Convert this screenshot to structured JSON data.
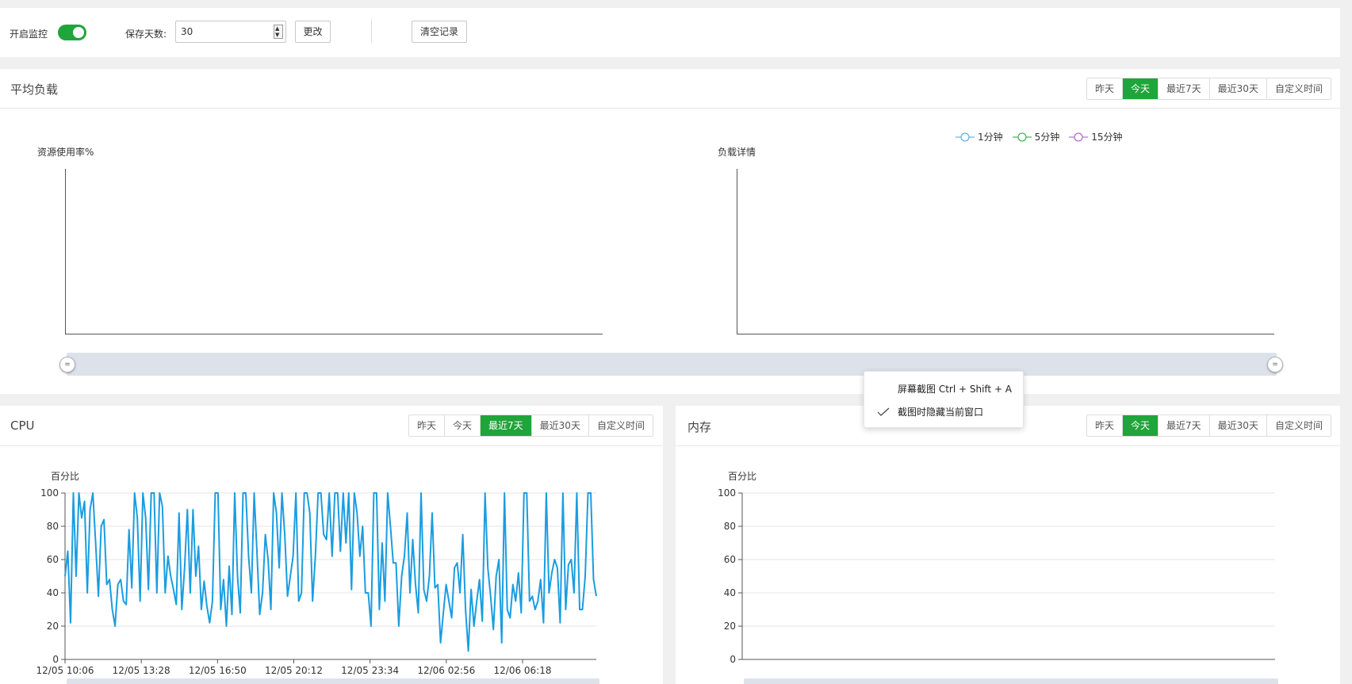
{
  "top": {
    "monitor_label": "开启监控",
    "monitor_on": true,
    "days_label": "保存天数:",
    "days_value": "30",
    "change_button": "更改",
    "clear_button": "清空记录"
  },
  "load": {
    "title": "平均负载",
    "range_buttons": [
      "昨天",
      "今天",
      "最近7天",
      "最近30天",
      "自定义时间"
    ],
    "active_range": "今天",
    "left_chart_label": "资源使用率%",
    "right_chart_label": "负载详情",
    "legend": [
      {
        "name": "1分钟",
        "color": "#4aa3df"
      },
      {
        "name": "5分钟",
        "color": "#20a53a"
      },
      {
        "name": "15分钟",
        "color": "#a44fd6"
      }
    ],
    "slider_handle_glyph": "="
  },
  "cpu": {
    "title": "CPU",
    "range_buttons": [
      "昨天",
      "今天",
      "最近7天",
      "最近30天",
      "自定义时间"
    ],
    "active_range": "最近7天",
    "color": "#1a9de0"
  },
  "memory": {
    "title": "内存",
    "range_buttons": [
      "昨天",
      "今天",
      "最近7天",
      "最近30天",
      "自定义时间"
    ],
    "active_range": "今天"
  },
  "context_menu": {
    "items": [
      {
        "label": "屏幕截图 Ctrl + Shift + A",
        "checked": false
      },
      {
        "label": "截图时隐藏当前窗口",
        "checked": true
      }
    ]
  },
  "chart_data": [
    {
      "type": "line",
      "ylabel": "资源使用率%",
      "series": []
    },
    {
      "type": "line",
      "ylabel": "负载详情",
      "series": [
        {
          "name": "1分钟",
          "values": []
        },
        {
          "name": "5分钟",
          "values": []
        },
        {
          "name": "15分钟",
          "values": []
        }
      ]
    },
    {
      "type": "line",
      "ylabel": "百分比",
      "ylim": [
        0,
        100
      ],
      "yticks": [
        "0",
        "20",
        "40",
        "60",
        "80",
        "100"
      ],
      "xticks": [
        "12/05 10:06",
        "12/05 13:28",
        "12/05 16:50",
        "12/05 20:12",
        "12/05 23:34",
        "12/06 02:56",
        "12/06 06:18"
      ],
      "grid": true,
      "series": [
        {
          "values": [
            50,
            65,
            22,
            100,
            50,
            100,
            85,
            95,
            40,
            90,
            100,
            70,
            38,
            80,
            84,
            45,
            48,
            30,
            20,
            45,
            48,
            35,
            33,
            78,
            43,
            100,
            85,
            35,
            100,
            85,
            42,
            100,
            100,
            40,
            100,
            92,
            40,
            62,
            50,
            42,
            33,
            88,
            30,
            55,
            90,
            40,
            90,
            50,
            68,
            30,
            47,
            32,
            22,
            35,
            100,
            100,
            30,
            48,
            20,
            56,
            27,
            100,
            50,
            28,
            100,
            100,
            62,
            40,
            100,
            65,
            27,
            40,
            75,
            60,
            30,
            100,
            88,
            55,
            100,
            75,
            38,
            50,
            62,
            100,
            35,
            40,
            100,
            100,
            88,
            35,
            62,
            100,
            100,
            75,
            72,
            100,
            62,
            100,
            100,
            65,
            100,
            70,
            100,
            42,
            100,
            88,
            62,
            80,
            40,
            40,
            20,
            100,
            100,
            30,
            70,
            35,
            100,
            80,
            58,
            58,
            20,
            50,
            62,
            88,
            40,
            72,
            45,
            28,
            100,
            42,
            35,
            50,
            88,
            43,
            45,
            10,
            28,
            45,
            35,
            25,
            55,
            58,
            40,
            75,
            30,
            5,
            42,
            20,
            35,
            48,
            23,
            100,
            55,
            38,
            18,
            50,
            60,
            10,
            100,
            30,
            25,
            45,
            35,
            52,
            28,
            100,
            100,
            35,
            38,
            30,
            35,
            48,
            22,
            100,
            40,
            52,
            60,
            55,
            22,
            100,
            30,
            57,
            60,
            40,
            100,
            30,
            30,
            50,
            100,
            100,
            48,
            38
          ]
        }
      ]
    },
    {
      "type": "line",
      "ylabel": "百分比",
      "ylim": [
        0,
        100
      ],
      "yticks": [
        "0",
        "20",
        "40",
        "60",
        "80",
        "100"
      ],
      "grid": true,
      "series": []
    }
  ]
}
